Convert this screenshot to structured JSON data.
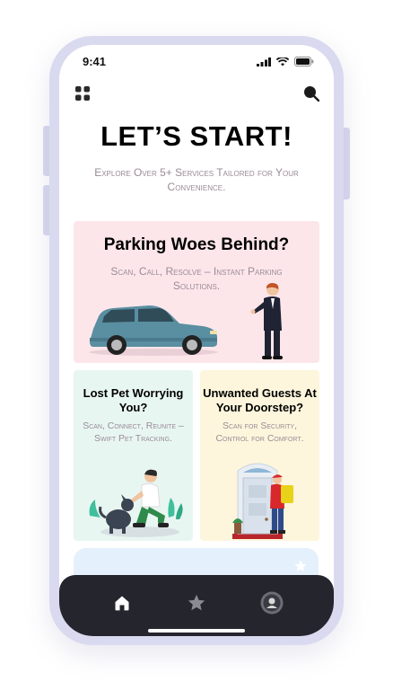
{
  "status_bar": {
    "time": "9:41",
    "icons": [
      "signal-icon",
      "wifi-icon",
      "battery-icon"
    ]
  },
  "top_bar": {
    "left_icon": "grid-menu-icon",
    "right_icon": "search-icon"
  },
  "header": {
    "title": "LET’S START!",
    "subtitle": "Explore Over 5+ Services Tailored for Your Convenience."
  },
  "services": {
    "parking": {
      "title": "Parking Woes Behind?",
      "description": "Scan, Call, Resolve – Instant Parking Solutions."
    },
    "pet": {
      "title": "Lost Pet Worrying You?",
      "description": "Scan, Connect, Reunite – Swift Pet Tracking."
    },
    "guests": {
      "title": "Unwanted Guests At Your Doorstep?",
      "description": "Scan for Security, Control for Comfort."
    }
  },
  "tab_bar": {
    "items": [
      "home-icon",
      "star-icon",
      "profile-avatar"
    ],
    "active": "home-icon"
  },
  "colors": {
    "frame": "#d9d9ef",
    "parking_card": "#fde6ea",
    "pet_card": "#e8f6f2",
    "guests_card": "#fdf6dc",
    "more_card": "#e4f0fc",
    "tab_bar": "#24252d",
    "subtitle_text": "#9a8b96"
  }
}
